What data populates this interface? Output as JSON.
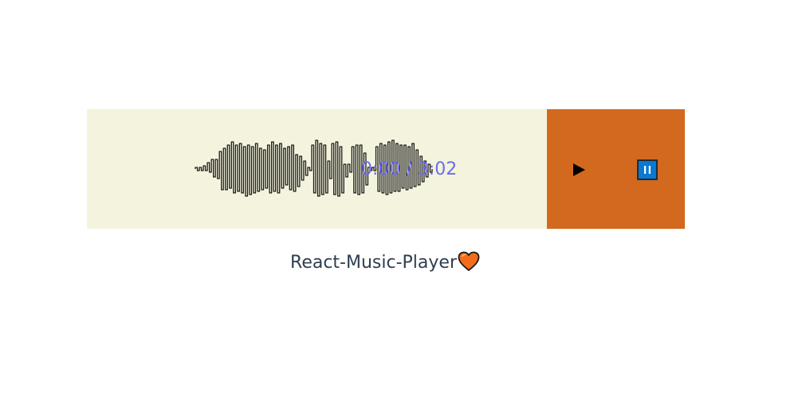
{
  "player": {
    "current_time": "0:00",
    "duration": "3:02",
    "time_display": "0:00 / 3:02",
    "colors": {
      "wave_panel_bg": "#f4f3dd",
      "controls_bg": "#d2691e",
      "time_text": "#6b6bf0",
      "pause_button_bg": "#0a78d4"
    },
    "play_icon": "play-icon",
    "pause_icon": "pause-icon"
  },
  "caption": {
    "text": "React-Music-Player",
    "heart_icon": "orange-heart-icon",
    "heart_color": "#f26d1b"
  }
}
